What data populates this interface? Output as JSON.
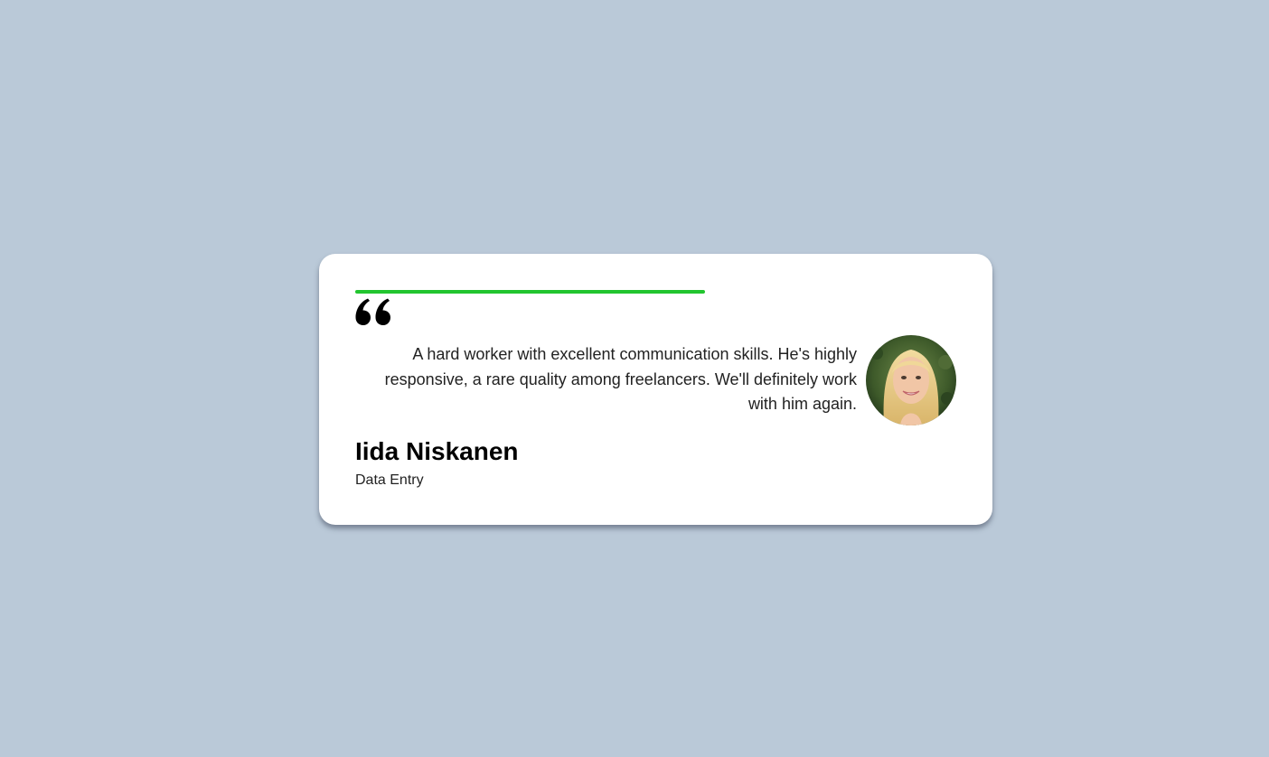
{
  "testimonial": {
    "quote": "A hard worker with excellent communication skills. He's highly responsive, a rare quality among freelancers. We'll definitely work with him again.",
    "author_name": "Iida Niskanen",
    "author_role": "Data Entry"
  },
  "icons": {
    "quote": "quote-icon"
  },
  "colors": {
    "background": "#bac9d8",
    "card": "#ffffff",
    "accent": "#22c52f",
    "text": "#222222"
  }
}
